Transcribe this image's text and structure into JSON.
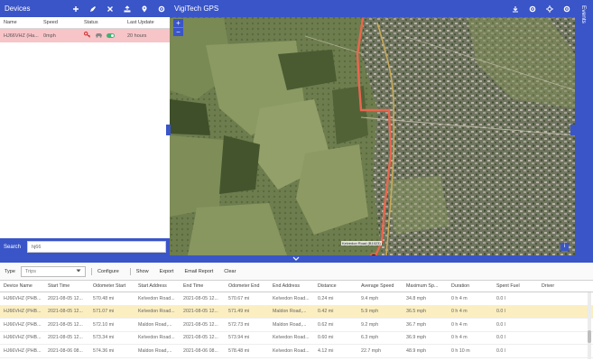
{
  "devices": {
    "title": "Devices",
    "toolbar_icons": [
      "add-icon",
      "edit-icon",
      "remove-icon",
      "share-icon",
      "location-icon",
      "settings-icon"
    ],
    "columns": [
      "Name",
      "Speed",
      "Status",
      "Last Update"
    ],
    "rows": [
      {
        "name": "HJ66VHZ (Ha...",
        "speed": "0mph",
        "last_update": "20 hours"
      }
    ],
    "search_label": "Search",
    "search_value": "hj66"
  },
  "map": {
    "title": "VigiTech GPS",
    "toolbar_icons": [
      "download-icon",
      "settings-icon",
      "locate-icon",
      "gear-icon"
    ],
    "zoom_in": "+",
    "zoom_out": "−",
    "place_label": "Kelvedon Road (B1023)",
    "info": "i"
  },
  "events": {
    "label": "Events"
  },
  "trips": {
    "type_label": "Type",
    "type_value": "Trips",
    "buttons": [
      "Configure",
      "Show",
      "Export",
      "Email Report",
      "Clear"
    ],
    "columns": [
      "Device Name",
      "Start Time",
      "Odometer Start",
      "Start Address",
      "End Time",
      "Odometer End",
      "End Address",
      "Distance",
      "Average Speed",
      "Maximum Sp...",
      "Duration",
      "Spent Fuel",
      "Driver"
    ],
    "rows": [
      [
        "HJ66VHZ (PHB...",
        "2021-08-05 12...",
        "570.48 mi",
        "Kelvedon Road...",
        "2021-08-05 12...",
        "570.67 mi",
        "Kelvedon Road...",
        "0.24 mi",
        "9.4 mph",
        "34.8 mph",
        "0 h 4 m",
        "0.0 l",
        ""
      ],
      [
        "HJ66VHZ (PHB...",
        "2021-08-05 12...",
        "571.07 mi",
        "Kelvedon Road...",
        "2021-08-05 12...",
        "571.49 mi",
        "Maldon Road,...",
        "0.42 mi",
        "5.9 mph",
        "36.5 mph",
        "0 h 4 m",
        "0.0 l",
        ""
      ],
      [
        "HJ66VHZ (PHB...",
        "2021-08-05 12...",
        "572.10 mi",
        "Maldon Road,...",
        "2021-08-05 12...",
        "572.73 mi",
        "Maldon Road,...",
        "0.62 mi",
        "9.2 mph",
        "36.7 mph",
        "0 h 4 m",
        "0.0 l",
        ""
      ],
      [
        "HJ66VHZ (PHB...",
        "2021-08-05 12...",
        "573.34 mi",
        "Kelvedon Road...",
        "2021-08-05 12...",
        "573.94 mi",
        "Kelvedon Road...",
        "0.60 mi",
        "6.3 mph",
        "36.9 mph",
        "0 h 4 m",
        "0.0 l",
        ""
      ],
      [
        "HJ66VHZ (PHB...",
        "2021-08-06 08...",
        "574.36 mi",
        "Maldon Road,...",
        "2021-08-06 08...",
        "578.48 mi",
        "Kelvedon Road...",
        "4.12 mi",
        "22.7 mph",
        "48.9 mph",
        "0 h 10 m",
        "0.0 l",
        ""
      ]
    ],
    "selected_row": 1
  },
  "colors": {
    "brand": "#3a55c8",
    "selected_device_row": "#f7c4c8",
    "selected_trip_row": "#fbeec0",
    "route": "#e8674f"
  }
}
